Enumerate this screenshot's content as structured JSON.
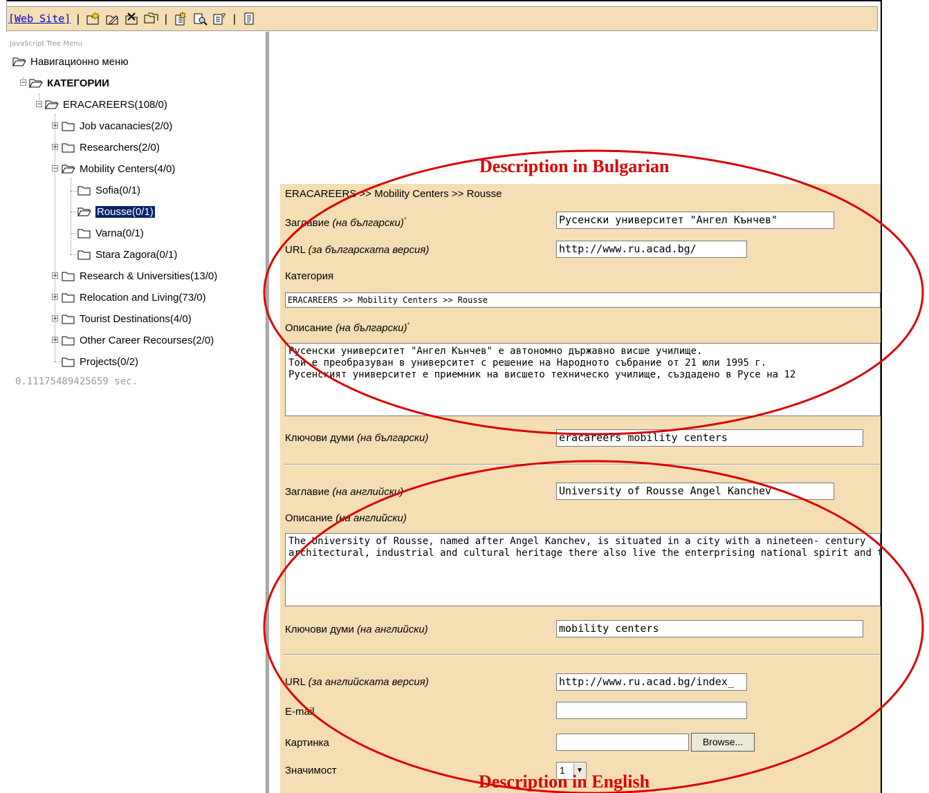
{
  "toolbar": {
    "website_link": "[Web Site]",
    "separator": "|",
    "icons": [
      "new-category-icon",
      "edit-category-icon",
      "delete-category-icon",
      "copy-category-icon",
      "new-link-icon",
      "search-link-icon",
      "edit-link-icon",
      "document-icon"
    ]
  },
  "tree": {
    "caption": "JavaScript Tree Menu",
    "root": "Навигационно меню",
    "categories": "КАТЕГОРИИ",
    "eracareers": "ERACAREERS(108/0)",
    "job": "Job vacanacies(2/0)",
    "researchers": "Researchers(2/0)",
    "mobility": "Mobility Centers(4/0)",
    "sofia": "Sofia(0/1)",
    "rousse": "Rousse(0/1)",
    "varna": "Varna(0/1)",
    "stara": "Stara Zagora(0/1)",
    "research": "Research & Universities(13/0)",
    "relocation": "Relocation and Living(73/0)",
    "tourist": "Tourist Destinations(4/0)",
    "other": "Other Career Recourses(2/0)",
    "projects": "Projects(0/2)"
  },
  "timing": "0.11175489425659 sec.",
  "form": {
    "breadcrumb": "ERACAREERS >> Mobility Centers >> Rousse",
    "title_bg_label": "Заглавие",
    "title_bg_hint": "(на български)",
    "title_bg_value": "Русенски университет \"Ангел Кънчев\"",
    "url_bg_label": "URL",
    "url_bg_hint": "(за българската версия)",
    "url_bg_value": "http://www.ru.acad.bg/",
    "category_label": "Категория",
    "category_value": "ERACAREERS >> Mobility Centers >> Rousse",
    "desc_bg_label": "Описание",
    "desc_bg_hint": "(на български)",
    "desc_bg_value": "Русенски университет \"Ангел Кънчев\" е автономно държавно висше училище.\nТой е преобразуван в университет с решение на Народното събрание от 21 юли 1995 г.\nРусенският университет е приемник на висшето техническо училище, създадено в Русе на 12",
    "keywords_bg_label": "Ключови думи",
    "keywords_bg_hint": "(на български)",
    "keywords_bg_value": "eracareers mobility centers",
    "title_en_label": "Заглавие",
    "title_en_hint": "(на английски)",
    "title_en_value": "University of Rousse Angel Kanchev",
    "desc_en_label": "Описание",
    "desc_en_hint": "(на английски)",
    "desc_en_value": "The University of Rousse, named after Angel Kanchev, is situated in a city with a nineteen- century\narchitectural, industrial and cultural heritage there also live the enterprising national spirit and the",
    "keywords_en_label": "Ключови думи",
    "keywords_en_hint": "(на английски)",
    "keywords_en_value": "mobility centers",
    "url_en_label": "URL",
    "url_en_hint": "(за английската версия)",
    "url_en_value": "http://www.ru.acad.bg/index_",
    "email_label": "E-mail",
    "email_value": "",
    "image_label": "Картинка",
    "browse_label": "Browse...",
    "priority_label": "Значимост",
    "priority_value": "1",
    "required_mark": "*"
  },
  "annotations": {
    "bulgarian": "Description in Bulgarian",
    "english": "Description in English",
    "color": "#dd0000"
  }
}
